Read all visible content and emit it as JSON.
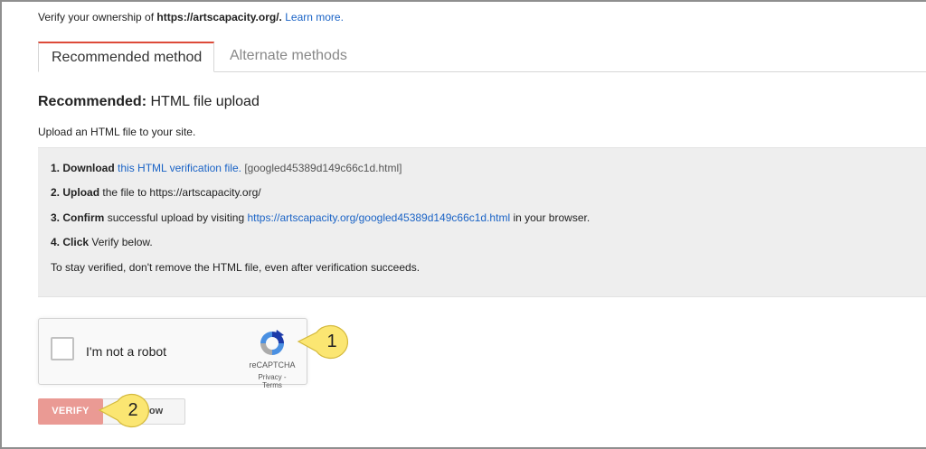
{
  "intro": {
    "prefix": "Verify your ownership of",
    "domain": "https://artscapacity.org/.",
    "learn_more": "Learn more."
  },
  "tabs": [
    {
      "label": "Recommended method"
    },
    {
      "label": "Alternate methods"
    }
  ],
  "heading": {
    "bold": "Recommended:",
    "rest": "HTML file upload"
  },
  "subtext": "Upload an HTML file to your site.",
  "steps": {
    "s1": {
      "num": "1.",
      "verb": "Download",
      "link": "this HTML verification file.",
      "file": "[googled45389d149c66c1d.html]"
    },
    "s2": {
      "num": "2.",
      "verb": "Upload",
      "rest": "the file to https://artscapacity.org/"
    },
    "s3": {
      "num": "3.",
      "verb": "Confirm",
      "rest": "successful upload by visiting",
      "link": "https://artscapacity.org/googled45389d149c66c1d.html",
      "tail": "in your browser."
    },
    "s4": {
      "num": "4.",
      "verb": "Click",
      "rest": "Verify below."
    },
    "note": "To stay verified, don't remove the HTML file, even after verification succeeds."
  },
  "captcha": {
    "label": "I'm not a robot",
    "brand": "reCAPTCHA",
    "links": "Privacy - Terms",
    "icon": "recaptcha-icon"
  },
  "callouts": {
    "one": "1",
    "two": "2"
  },
  "buttons": {
    "verify": "VERIFY",
    "not_now": "Not now"
  },
  "colors": {
    "link": "#1a63c6",
    "active_tab_border": "#dd4b39",
    "verify_button": "#ea9a94",
    "callout_fill": "#fbe672",
    "steps_background": "#eeeeee"
  }
}
